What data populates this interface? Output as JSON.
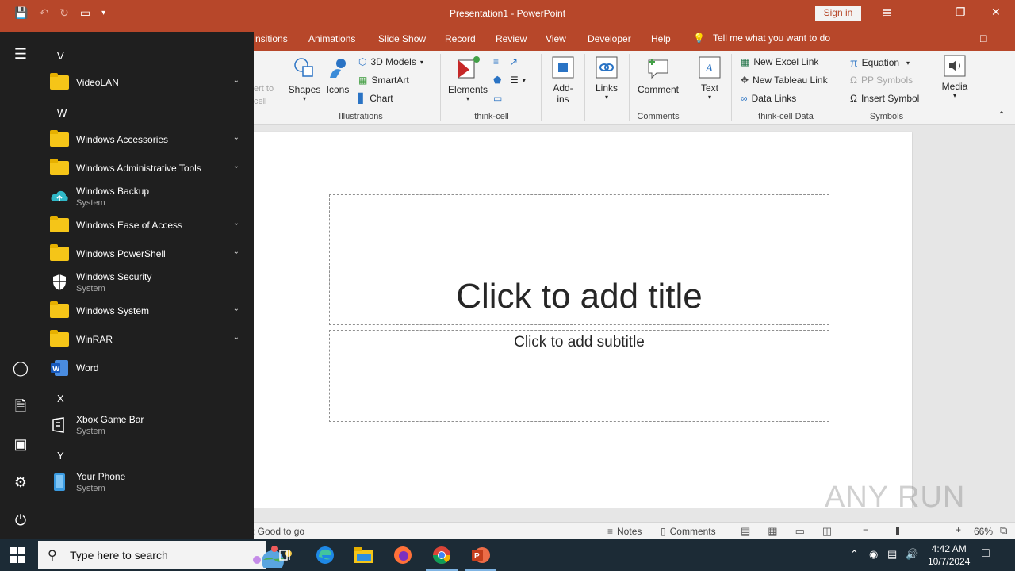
{
  "titlebar": {
    "title": "Presentation1  -  PowerPoint",
    "signin": "Sign in"
  },
  "ribbon_tabs": [
    "nsitions",
    "Animations",
    "Slide Show",
    "Record",
    "Review",
    "View",
    "Developer",
    "Help"
  ],
  "tell_me": "Tell me what you want to do",
  "ribbon": {
    "partial_button": "ert to\ncell",
    "shapes": "Shapes",
    "icons": "Icons",
    "models3d": "3D Models",
    "smartart": "SmartArt",
    "chart": "Chart",
    "illustrations_group": "Illustrations",
    "elements": "Elements",
    "thinkcell_group": "think-cell",
    "addins": "Add-\nins",
    "links": "Links",
    "comment": "Comment",
    "comments_group": "Comments",
    "text": "Text",
    "new_excel_link": "New Excel Link",
    "new_tableau_link": "New Tableau Link",
    "data_links": "Data Links",
    "thinkcell_data_group": "think-cell Data",
    "equation": "Equation",
    "pp_symbols": "PP Symbols",
    "insert_symbol": "Insert Symbol",
    "symbols_group": "Symbols",
    "media": "Media"
  },
  "slide": {
    "title_placeholder": "Click to add title",
    "subtitle_placeholder": "Click to add subtitle"
  },
  "statusbar": {
    "accessibility": "y: Good to go",
    "notes": "Notes",
    "comments": "Comments",
    "zoom": "66%"
  },
  "start_menu": {
    "letters": {
      "v": "V",
      "w": "W",
      "x": "X",
      "y": "Y"
    },
    "apps": [
      {
        "name": "VideoLAN",
        "type": "folder",
        "expandable": true
      },
      {
        "name": "Windows Accessories",
        "type": "folder",
        "expandable": true
      },
      {
        "name": "Windows Administrative Tools",
        "type": "folder",
        "expandable": true
      },
      {
        "name": "Windows Backup",
        "sub": "System",
        "type": "app"
      },
      {
        "name": "Windows Ease of Access",
        "type": "folder",
        "expandable": true
      },
      {
        "name": "Windows PowerShell",
        "type": "folder",
        "expandable": true
      },
      {
        "name": "Windows Security",
        "sub": "System",
        "type": "app"
      },
      {
        "name": "Windows System",
        "type": "folder",
        "expandable": true
      },
      {
        "name": "WinRAR",
        "type": "folder",
        "expandable": true
      },
      {
        "name": "Word",
        "type": "app"
      },
      {
        "name": "Xbox Game Bar",
        "sub": "System",
        "type": "app"
      },
      {
        "name": "Your Phone",
        "sub": "System",
        "type": "app"
      }
    ]
  },
  "taskbar": {
    "search_placeholder": "Type here to search",
    "time": "4:42 AM",
    "date": "10/7/2024"
  },
  "watermark": "ANY RUN",
  "colors": {
    "accent": "#b7472a",
    "start_bg": "#1f1f1f",
    "taskbar_bg": "#1c2b36"
  }
}
